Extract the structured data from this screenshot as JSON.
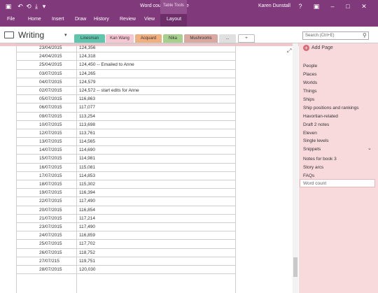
{
  "window": {
    "title": "Word count - OneNote",
    "user": "Karen Dunstall",
    "help": "?",
    "colors": {
      "accent": "#80397B"
    }
  },
  "ribbon": {
    "file": "File",
    "home": "Home",
    "insert": "Insert",
    "draw": "Draw",
    "history": "History",
    "review": "Review",
    "view": "View",
    "table_tools": "Table Tools",
    "layout": "Layout"
  },
  "notebook": {
    "name": "Writing",
    "tabs": [
      "Linesman",
      "Kan Wang",
      "Acquard",
      "Nika",
      "Mushrooms",
      "...",
      "+"
    ],
    "search_placeholder": "Search (Ctrl+E)"
  },
  "table": {
    "rows": [
      [
        "23/04/2015",
        "124,356"
      ],
      [
        "24/04/2015",
        "124,318"
      ],
      [
        "25/04/2015",
        "124,450 -- Emailed to Anne"
      ],
      [
        "03/07/2015",
        "124,265"
      ],
      [
        "04/07/2015",
        "124,579"
      ],
      [
        "02/07/2015",
        "124,572 -- start edits for Anne"
      ],
      [
        "05/07/2015",
        "116,863"
      ],
      [
        "06/07/2015",
        "117,077"
      ],
      [
        "09/07/2015",
        "113,254"
      ],
      [
        "10/07/2015",
        "113,698"
      ],
      [
        "12/07/2015",
        "113,761"
      ],
      [
        "13/07/2015",
        "114,565"
      ],
      [
        "14/07/2015",
        "114,690"
      ],
      [
        "15/07/2015",
        "114,981"
      ],
      [
        "16/07/2015",
        "115,081"
      ],
      [
        "17/07/2015",
        "114,853"
      ],
      [
        "18/07/2015",
        "115,302"
      ],
      [
        "19/07/2015",
        "116,394"
      ],
      [
        "22/07/2015",
        "117,490"
      ],
      [
        "20/07/2015",
        "116,854"
      ],
      [
        "21/07/2015",
        "117,214"
      ],
      [
        "23/07/2015",
        "117,490"
      ],
      [
        "24/07/2015",
        "116,859"
      ],
      [
        "25/07/2015",
        "117,702"
      ],
      [
        "26/07/2015",
        "118,752"
      ],
      [
        "27/07/215",
        "119,751"
      ],
      [
        "28/07/2015",
        "120,030"
      ]
    ]
  },
  "pages": {
    "add_page": "Add Page",
    "items": [
      "People",
      "Places",
      "Worlds",
      "Things",
      "Ships",
      "Ship positions and rankings",
      "Havortian-related",
      "Draft 2 notes",
      "Eleven",
      "Single levels",
      "Snippets",
      "Notes for book 3",
      "Story arcs",
      "FAQs",
      "Word count"
    ]
  }
}
